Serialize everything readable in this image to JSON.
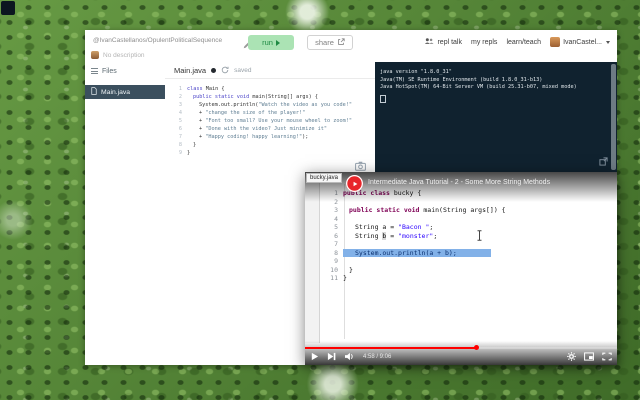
{
  "topbar": {
    "title": "@IvanCastellanos/OpulentPoliticalSequence",
    "description": "No description",
    "run_label": "run",
    "share_label": "share",
    "nav_talk": "repl talk",
    "nav_repls": "my repls",
    "nav_learn": "learn/teach",
    "user_label": "IvanCastel..."
  },
  "files": {
    "header": "Files",
    "file_name": "Main.java"
  },
  "editor": {
    "tab_label": "Main.java",
    "saved_label": "saved",
    "code": [
      {
        "n": "1",
        "indent": 0,
        "tokens": [
          [
            "kw",
            "class"
          ],
          [
            "pl",
            " Main {"
          ]
        ]
      },
      {
        "n": "2",
        "indent": 1,
        "tokens": [
          [
            "kw",
            "public"
          ],
          [
            "pl",
            " "
          ],
          [
            "kw",
            "static"
          ],
          [
            "pl",
            " "
          ],
          [
            "kw",
            "void"
          ],
          [
            "pl",
            " main(String[] args) {"
          ]
        ]
      },
      {
        "n": "3",
        "indent": 2,
        "tokens": [
          [
            "pl",
            "System.out.println("
          ],
          [
            "str",
            "\"Watch the video as you code!\""
          ]
        ]
      },
      {
        "n": "4",
        "indent": 2,
        "tokens": [
          [
            "pl",
            "+ "
          ],
          [
            "str",
            "\"change the size of the player!\""
          ]
        ]
      },
      {
        "n": "5",
        "indent": 2,
        "tokens": [
          [
            "pl",
            "+ "
          ],
          [
            "str",
            "\"Font too small? Use your mouse wheel to zoom!\""
          ]
        ]
      },
      {
        "n": "6",
        "indent": 2,
        "tokens": [
          [
            "pl",
            "+ "
          ],
          [
            "str",
            "\"Done with the video? Just minimize it\""
          ]
        ]
      },
      {
        "n": "7",
        "indent": 2,
        "tokens": [
          [
            "pl",
            "+ "
          ],
          [
            "str",
            "\"Happy coding! happy learning!\""
          ],
          [
            "pl",
            ");"
          ]
        ]
      },
      {
        "n": "8",
        "indent": 1,
        "tokens": [
          [
            "pl",
            "}"
          ]
        ]
      },
      {
        "n": "9",
        "indent": 0,
        "tokens": [
          [
            "pl",
            "}"
          ]
        ]
      }
    ]
  },
  "console": {
    "lines": [
      "java version \"1.8.0_31\"",
      "Java(TM) SE Runtime Environment (build 1.8.0_31-b13)",
      "Java HotSpot(TM) 64-Bit Server VM (build 25.31-b07, mixed mode)"
    ]
  },
  "video": {
    "tab_label": "bucky.java",
    "title": "Intermediate Java Tutorial - 2 - Some More String Methods",
    "time_label": "4:58 / 9:06",
    "progress_pct": 55,
    "code": [
      {
        "n": "1",
        "indent": 0,
        "tokens": [
          [
            "kw",
            "public"
          ],
          [
            "pl",
            " "
          ],
          [
            "kw",
            "class"
          ],
          [
            "pl",
            " bucky {"
          ]
        ]
      },
      {
        "n": "2",
        "indent": 0,
        "tokens": []
      },
      {
        "n": "3",
        "indent": 1,
        "tokens": [
          [
            "kw",
            "public"
          ],
          [
            "pl",
            " "
          ],
          [
            "kw",
            "static"
          ],
          [
            "pl",
            " "
          ],
          [
            "kw",
            "void"
          ],
          [
            "pl",
            " main(String args[]) {"
          ]
        ]
      },
      {
        "n": "4",
        "indent": 0,
        "tokens": []
      },
      {
        "n": "5",
        "indent": 2,
        "tokens": [
          [
            "pl",
            "String a = "
          ],
          [
            "str",
            "\"Bacon \""
          ],
          [
            "pl",
            ";"
          ]
        ]
      },
      {
        "n": "6",
        "indent": 2,
        "tokens": [
          [
            "pl",
            "String "
          ],
          [
            "occ",
            "b"
          ],
          [
            "pl",
            " = "
          ],
          [
            "str",
            "\"monster\""
          ],
          [
            "pl",
            ";"
          ]
        ]
      },
      {
        "n": "7",
        "indent": 0,
        "tokens": []
      },
      {
        "n": "8",
        "indent": 2,
        "hl": true,
        "tokens": [
          [
            "pl",
            "System.out.println(a + b);"
          ]
        ]
      },
      {
        "n": "9",
        "indent": 0,
        "tokens": []
      },
      {
        "n": "10",
        "indent": 1,
        "tokens": [
          [
            "pl",
            "}"
          ]
        ]
      },
      {
        "n": "11",
        "indent": 0,
        "tokens": [
          [
            "pl",
            "}"
          ]
        ]
      }
    ]
  },
  "colors": {
    "run_green": "#1f8a43",
    "file_selected_bg": "#3b4f5e",
    "console_bg": "#10222f",
    "progress_red": "#ff0000",
    "channel_logo_red": "#e8252a",
    "eclipse_keyword": "#7f0055",
    "eclipse_string": "#2a00ff",
    "selection_blue": "#82b1e8"
  },
  "icons": [
    "pencil-icon",
    "play-icon",
    "share-icon",
    "people-icon",
    "hamburger-icon",
    "file-icon",
    "refresh-icon",
    "camera-icon",
    "popout-icon",
    "play-circle-logo",
    "next-icon",
    "volume-icon",
    "settings-icon",
    "miniplayer-icon",
    "fullscreen-icon",
    "text-cursor-icon"
  ]
}
